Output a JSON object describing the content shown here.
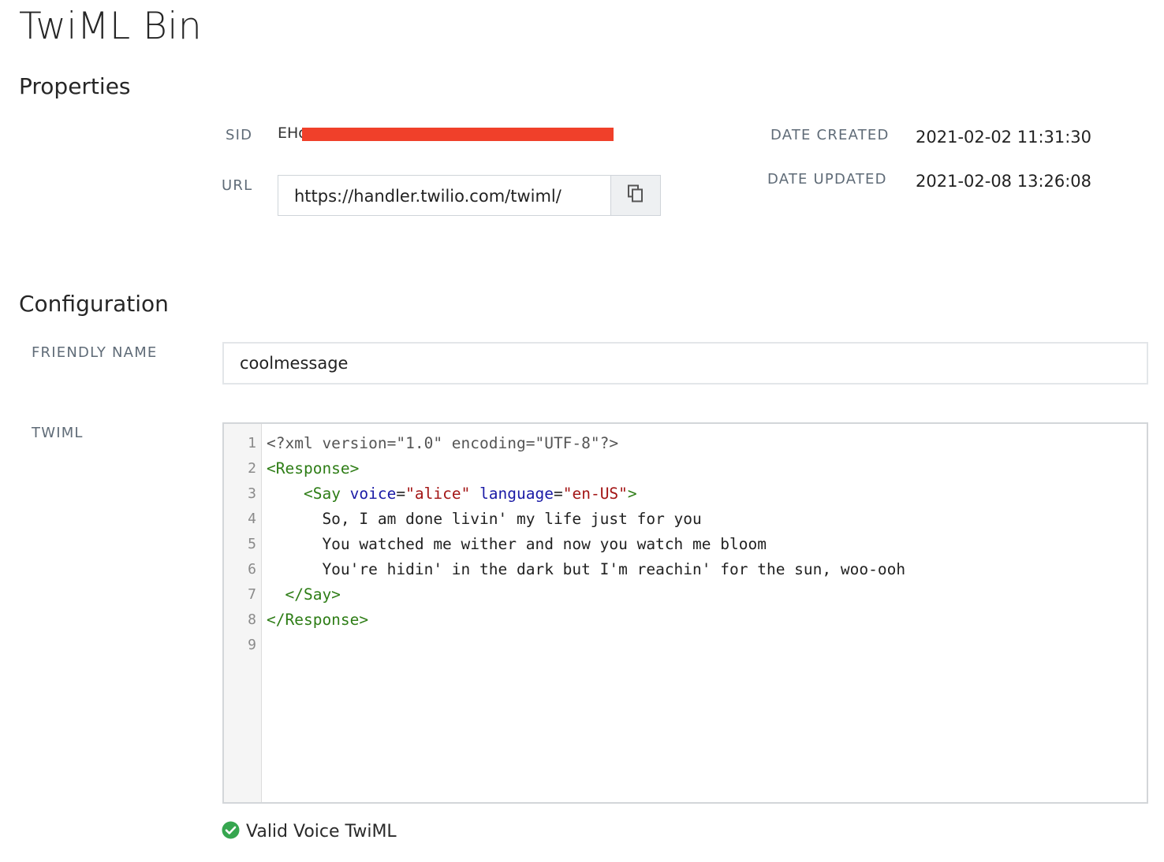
{
  "page": {
    "title": "TwiML Bin"
  },
  "properties": {
    "heading": "Properties",
    "sid_label": "SID",
    "sid_value": "EHc",
    "url_label": "URL",
    "url_value": "https://handler.twilio.com/twiml/",
    "date_created_label": "DATE CREATED",
    "date_created_value": "2021-02-02 11:31:30",
    "date_updated_label": "DATE UPDATED",
    "date_updated_value": "2021-02-08 13:26:08",
    "copy_icon": "copy-icon",
    "redaction_color": "#f0402a"
  },
  "configuration": {
    "heading": "Configuration",
    "friendly_name_label": "FRIENDLY NAME",
    "friendly_name_value": "coolmessage",
    "twiml_label": "TWIML",
    "line_numbers": [
      "1",
      "2",
      "3",
      "4",
      "5",
      "6",
      "7",
      "8",
      "9"
    ],
    "code_lines": [
      [
        {
          "t": "meta",
          "v": "<?xml version=\"1.0\" encoding=\"UTF-8\"?>"
        }
      ],
      [
        {
          "t": "tag",
          "v": "<Response>"
        }
      ],
      [
        {
          "t": "plain",
          "v": "    "
        },
        {
          "t": "tag",
          "v": "<Say "
        },
        {
          "t": "attr",
          "v": "voice"
        },
        {
          "t": "plain",
          "v": "="
        },
        {
          "t": "str",
          "v": "\"alice\""
        },
        {
          "t": "plain",
          "v": " "
        },
        {
          "t": "attr",
          "v": "language"
        },
        {
          "t": "plain",
          "v": "="
        },
        {
          "t": "str",
          "v": "\"en-US\""
        },
        {
          "t": "tag",
          "v": ">"
        }
      ],
      [
        {
          "t": "plain",
          "v": "      So, I am done livin' my life just for you"
        }
      ],
      [
        {
          "t": "plain",
          "v": "      You watched me wither and now you watch me bloom"
        }
      ],
      [
        {
          "t": "plain",
          "v": "      You're hidin' in the dark but I'm reachin' for the sun, woo-ooh"
        }
      ],
      [
        {
          "t": "plain",
          "v": "  "
        },
        {
          "t": "tag",
          "v": "</Say>"
        }
      ],
      [
        {
          "t": "tag",
          "v": "</Response>"
        }
      ],
      []
    ]
  },
  "status": {
    "icon": "check-circle-icon",
    "text": "Valid Voice TwiML",
    "color": "#36a64f"
  }
}
